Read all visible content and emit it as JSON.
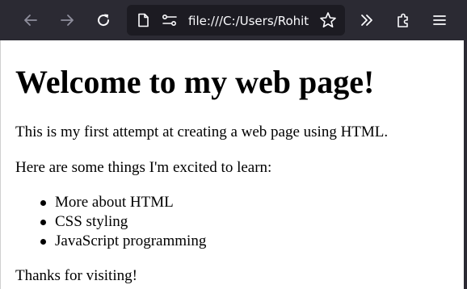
{
  "browser": {
    "url": "file:///C:/Users/Rohit",
    "colors": {
      "toolbar": "#2b2a33",
      "urlbar": "#1c1b22",
      "icon": "#fbfbfe",
      "icon_disabled": "#8f8f9d"
    }
  },
  "page": {
    "heading": "Welcome to my web page!",
    "intro": "This is my first attempt at creating a web page using HTML.",
    "list_intro": "Here are some things I'm excited to learn:",
    "items": [
      "More about HTML",
      "CSS styling",
      "JavaScript programming"
    ],
    "closing": "Thanks for visiting!"
  }
}
